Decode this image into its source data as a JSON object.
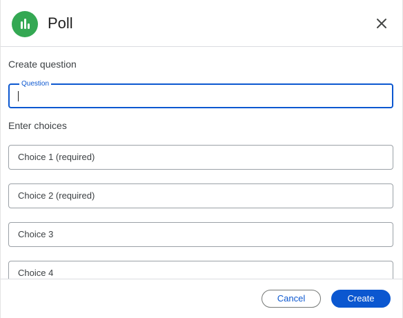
{
  "header": {
    "title": "Poll",
    "icon": "poll-chart-icon",
    "close_icon": "close-icon"
  },
  "question_section": {
    "label": "Create question",
    "field_label": "Question",
    "value": ""
  },
  "choices_section": {
    "label": "Enter choices",
    "choices": [
      {
        "placeholder": "Choice 1 (required)"
      },
      {
        "placeholder": "Choice 2 (required)"
      },
      {
        "placeholder": "Choice 3"
      },
      {
        "placeholder": "Choice 4"
      }
    ]
  },
  "footer": {
    "cancel_label": "Cancel",
    "create_label": "Create"
  },
  "colors": {
    "accent": "#0b57d0",
    "icon_bg": "#34a853"
  }
}
